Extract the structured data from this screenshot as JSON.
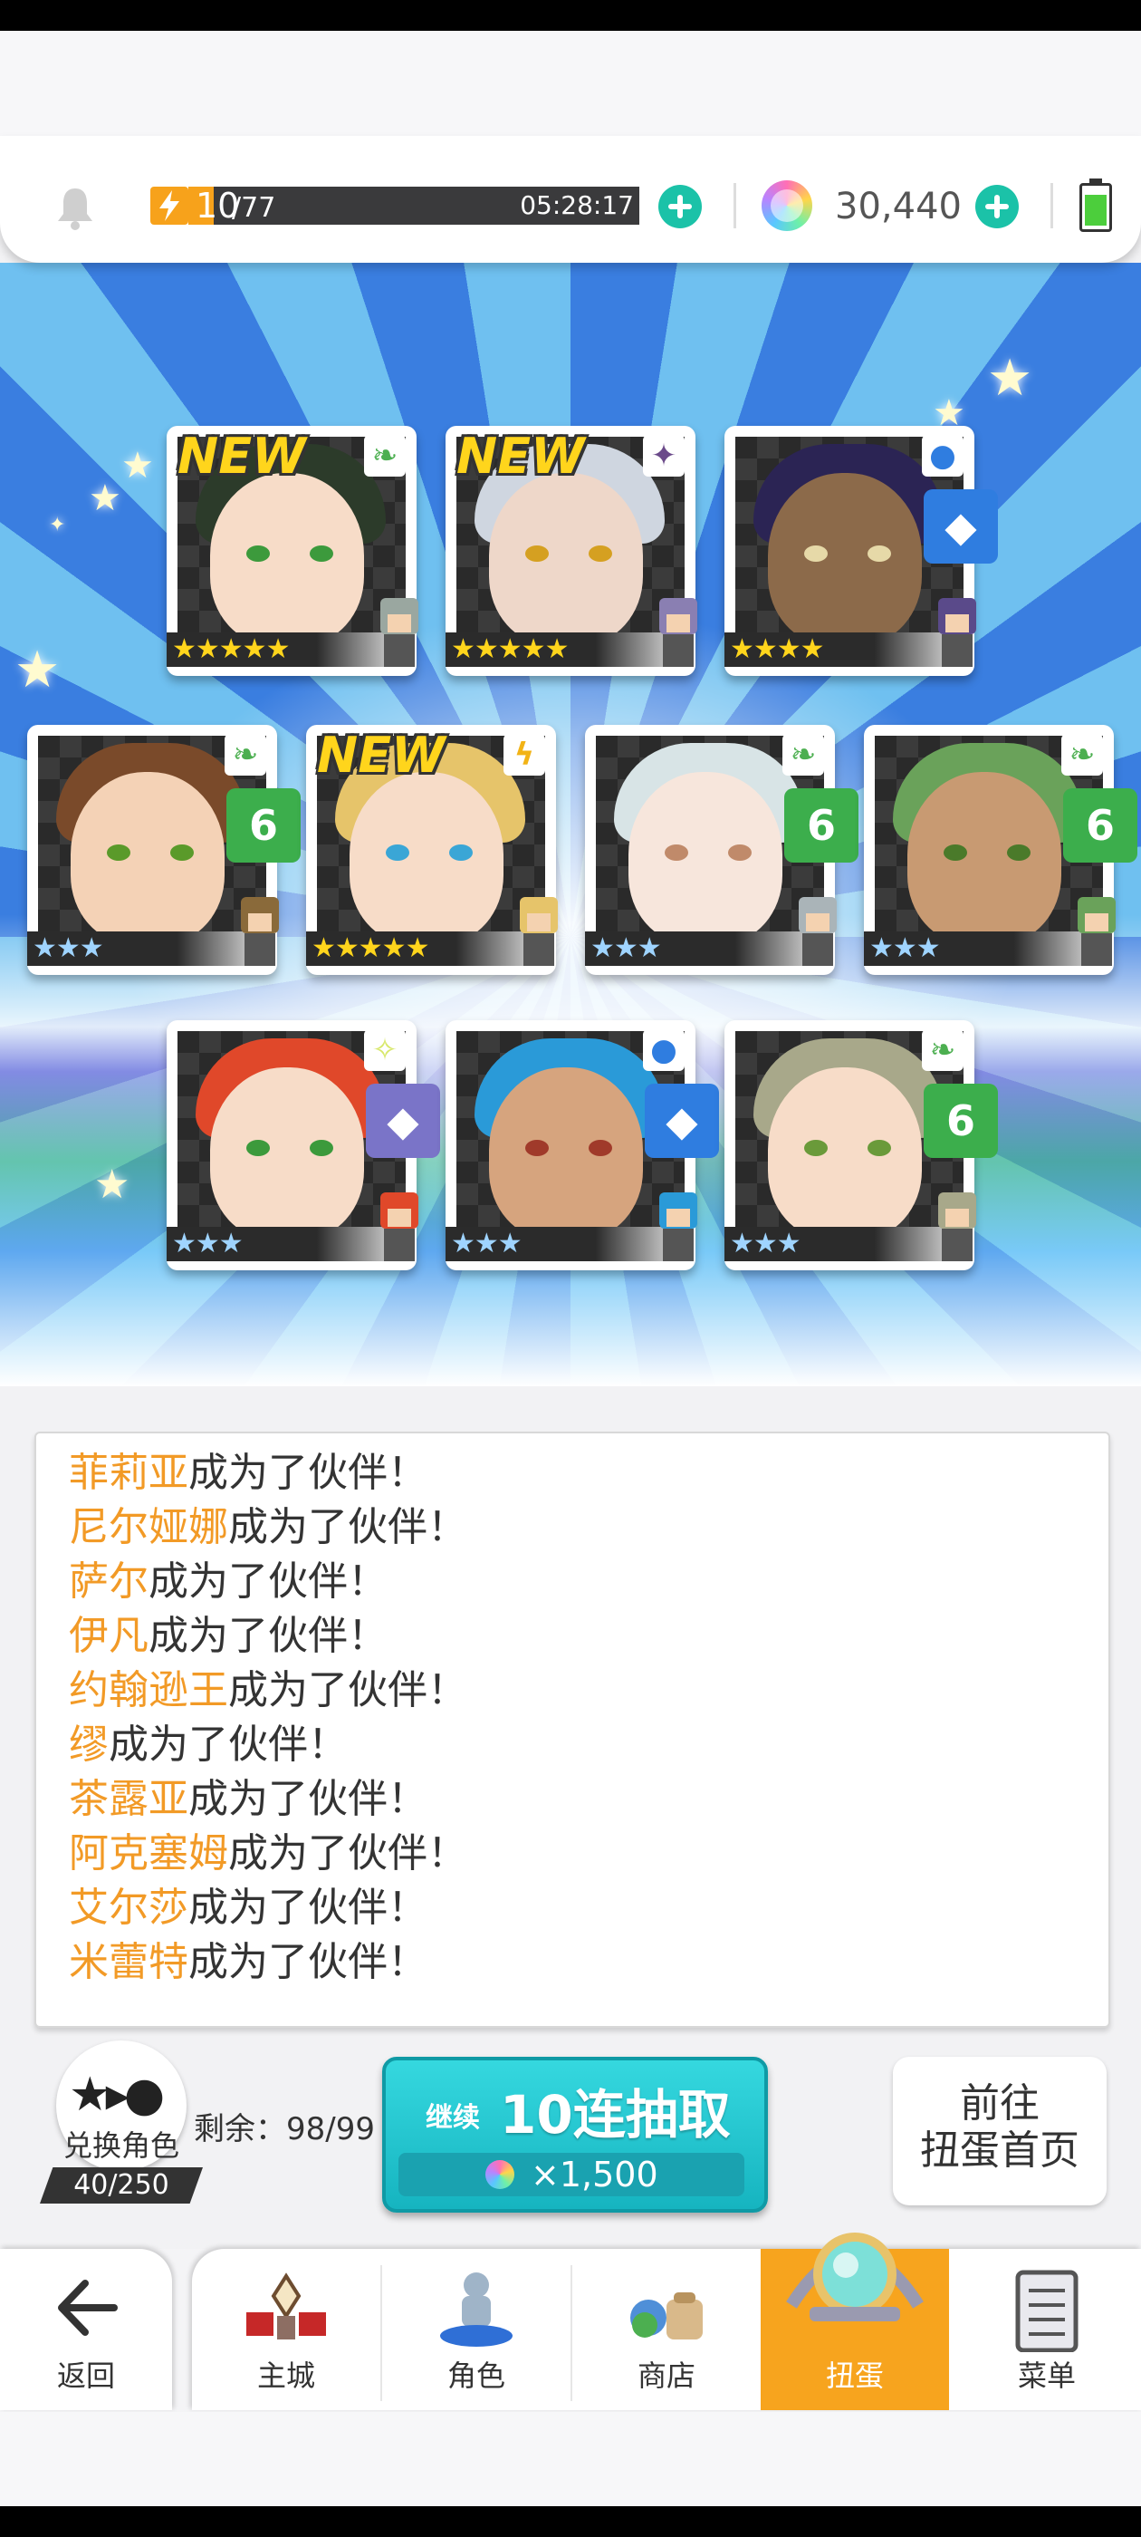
{
  "header": {
    "stamina_current": "10",
    "stamina_max": "/77",
    "stamina_timer": "05:28:17",
    "gem_count": "30,440"
  },
  "cards": [
    {
      "new_label": "NEW",
      "stars": "★★★★★",
      "element": "leaf",
      "element_color": "#4caf50"
    },
    {
      "new_label": "NEW",
      "stars": "★★★★★",
      "element": "dark",
      "element_color": "#6b4a8a"
    },
    {
      "new_label": "",
      "stars": "★★★★",
      "element": "water",
      "element_color": "#2f7de0"
    },
    {
      "new_label": "",
      "stars": "★★★",
      "element": "leaf",
      "element_color": "#4caf50"
    },
    {
      "new_label": "NEW",
      "stars": "★★★★★",
      "element": "thunder",
      "element_color": "#f2b316"
    },
    {
      "new_label": "",
      "stars": "★★★",
      "element": "leaf",
      "element_color": "#4caf50"
    },
    {
      "new_label": "",
      "stars": "★★★",
      "element": "leaf",
      "element_color": "#4caf50"
    },
    {
      "new_label": "",
      "stars": "★★★",
      "element": "light",
      "element_color": "#d8e86a"
    },
    {
      "new_label": "",
      "stars": "★★★",
      "element": "water",
      "element_color": "#2f7de0"
    },
    {
      "new_label": "",
      "stars": "★★★",
      "element": "leaf",
      "element_color": "#4caf50"
    }
  ],
  "log": {
    "suffix": "成为了伙伴！",
    "names": [
      "菲莉亚",
      "尼尔娅娜",
      "萨尔",
      "伊凡",
      "约翰逊王",
      "缪",
      "茶露亚",
      "阿克塞姆",
      "艾尔莎",
      "米蕾特"
    ]
  },
  "exchange": {
    "label": "兑换角色",
    "count": "40/250"
  },
  "remaining": "剩余：98/99",
  "pull_button": {
    "continue_label": "继续",
    "label": "10连抽取",
    "cost": "×1,500"
  },
  "goto_button": {
    "line1": "前往",
    "line2": "扭蛋首页"
  },
  "nav": {
    "back": "返回",
    "main_city": "主城",
    "characters": "角色",
    "shop": "商店",
    "gacha": "扭蛋",
    "menu": "菜单"
  },
  "colors": {
    "accent_orange": "#f7a41e",
    "teal_button": "#16b4c0",
    "name_highlight": "#f29a26"
  }
}
